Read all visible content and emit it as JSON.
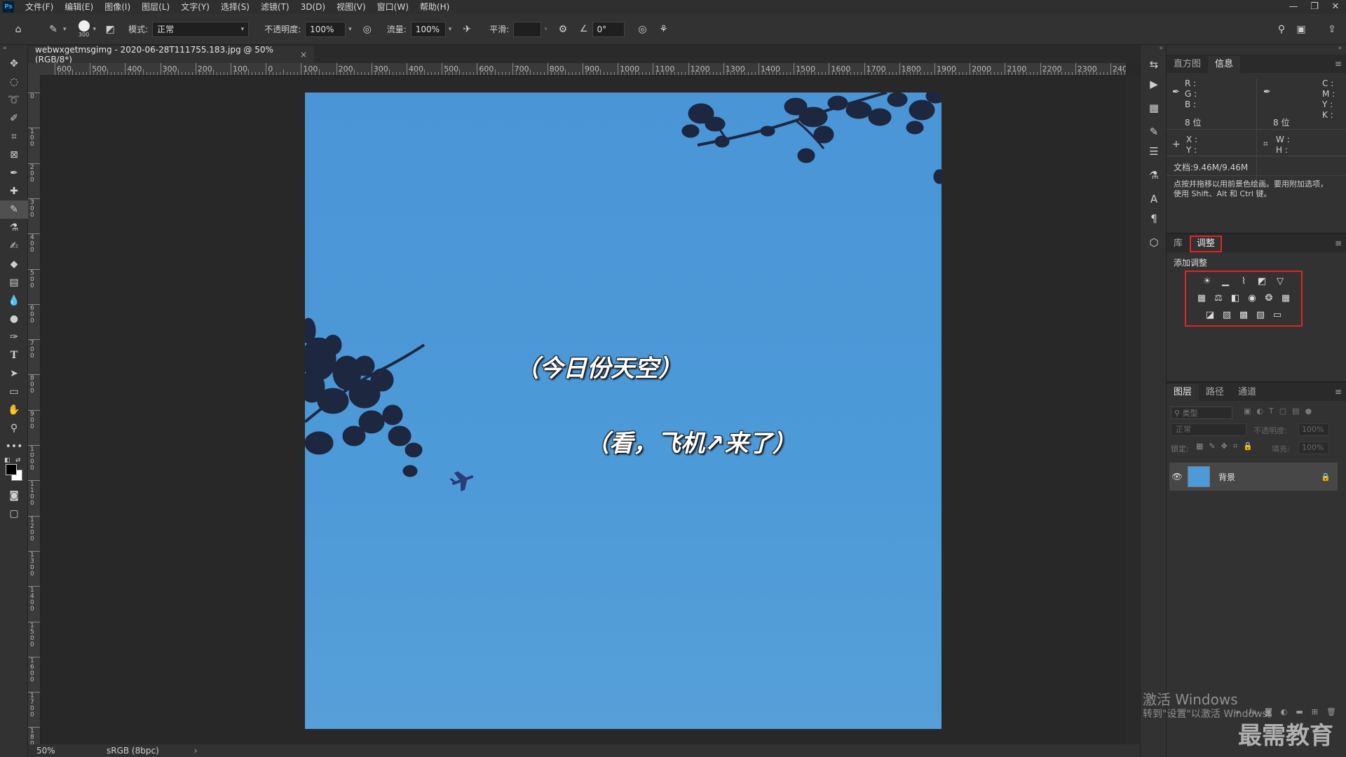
{
  "app": {
    "logo": "Ps"
  },
  "menu": [
    "文件(F)",
    "编辑(E)",
    "图像(I)",
    "图层(L)",
    "文字(Y)",
    "选择(S)",
    "滤镜(T)",
    "3D(D)",
    "视图(V)",
    "窗口(W)",
    "帮助(H)"
  ],
  "options": {
    "brush_size": "300",
    "mode_label": "模式:",
    "mode_value": "正常",
    "opacity_label": "不透明度:",
    "opacity_value": "100%",
    "flow_label": "流量:",
    "flow_value": "100%",
    "smooth_label": "平滑:",
    "smooth_value": "",
    "angle_value": "0°"
  },
  "document": {
    "tab_title": "webwxgetmsgimg - 2020-06-28T111755.183.jpg @ 50%(RGB/8*)",
    "close": "×",
    "caption1": "（今日份天空）",
    "caption2": "（看，飞机↗来了）"
  },
  "ruler": {
    "top_labels": [
      "600",
      "500",
      "400",
      "300",
      "200",
      "100",
      "0",
      "100",
      "200",
      "300",
      "400",
      "500",
      "600",
      "700",
      "800",
      "900",
      "1000",
      "1100",
      "1200",
      "1300",
      "1400",
      "1500",
      "1600",
      "1700",
      "1800",
      "1900",
      "2000",
      "2100",
      "2200",
      "2300",
      "2400"
    ],
    "left_labels": [
      "0",
      "1\n0\n0",
      "2\n0\n0",
      "3\n0\n0",
      "4\n0\n0",
      "5\n0\n0",
      "6\n0\n0",
      "7\n0\n0",
      "8\n0\n0",
      "9\n0\n0",
      "1\n0\n0\n0",
      "1\n1\n0\n0",
      "1\n2\n0\n0",
      "1\n3\n0\n0",
      "1\n4\n0\n0",
      "1\n5\n0\n0",
      "1\n6\n0\n0",
      "1\n7\n0\n0",
      "1\n8\n0\n0"
    ]
  },
  "status": {
    "zoom": "50%",
    "profile": "sRGB (8bpc)",
    "arrow": "›"
  },
  "info_panel": {
    "tabs": [
      "直方图",
      "信息"
    ],
    "r": "R :",
    "g": "G :",
    "b": "B :",
    "bits1": "8 位",
    "c": "C :",
    "m": "M :",
    "y": "Y :",
    "k": "K :",
    "bits2": "8 位",
    "x": "X :",
    "yy": "Y :",
    "w": "W :",
    "h": "H :",
    "doc": "文档:9.46M/9.46M",
    "hint": "点按并拖移以用前景色绘画。要用附加选项，使用 Shift、Alt 和 Ctrl 键。"
  },
  "adjust_panel": {
    "tabs": [
      "库",
      "调整"
    ],
    "add_label": "添加调整"
  },
  "layers_panel": {
    "tabs": [
      "图层",
      "路径",
      "通道"
    ],
    "filter_placeholder": "类型",
    "blend": "正常",
    "opacity_label": "不透明度:",
    "opacity_value": "100%",
    "lock_label": "锁定:",
    "fill_label": "填充:",
    "fill_value": "100%",
    "layer_name": "背景"
  },
  "watermark": {
    "activate_title": "激活 Windows",
    "activate_sub": "转到\"设置\"以激活 Windows。",
    "brand": "最需教育"
  },
  "colors": {
    "highlight_red": "#e02424",
    "sky_blue": "#4d9ad8"
  }
}
